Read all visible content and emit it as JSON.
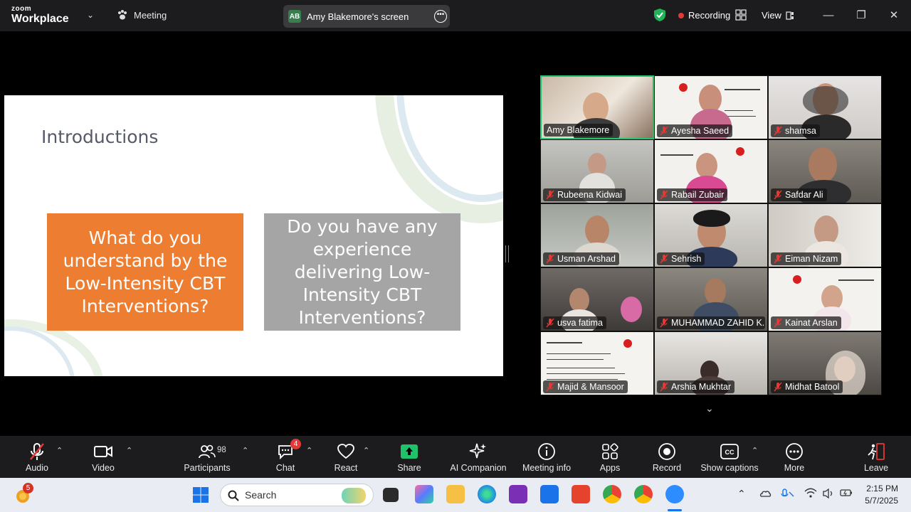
{
  "app": {
    "logo_top": "zoom",
    "logo_bottom": "Workplace"
  },
  "topbar": {
    "meeting_label": "Meeting",
    "screen_initials": "AB",
    "screen_title": "Amy Blakemore's screen",
    "recording_label": "Recording",
    "view_label": "View"
  },
  "slide": {
    "title": "Introductions",
    "box_left": "What do you understand by the Low-Intensity CBT Interventions?",
    "box_right": "Do you have any experience delivering Low-Intensity CBT Interventions?"
  },
  "participants": [
    {
      "name": "Amy Blakemore",
      "muted": false,
      "active": true
    },
    {
      "name": "Ayesha Saeed",
      "muted": true
    },
    {
      "name": "shamsa",
      "muted": true
    },
    {
      "name": "Rubeena Kidwai",
      "muted": true
    },
    {
      "name": "Rabail Zubair",
      "muted": true
    },
    {
      "name": "Safdar Ali",
      "muted": true
    },
    {
      "name": "Usman Arshad",
      "muted": true
    },
    {
      "name": "Sehrish",
      "muted": true
    },
    {
      "name": "Eiman Nizam",
      "muted": true
    },
    {
      "name": "usva fatima",
      "muted": true
    },
    {
      "name": "MUHAMMAD ZAHID K...",
      "muted": true
    },
    {
      "name": "Kainat Arslan",
      "muted": true
    },
    {
      "name": "Majid & Mansoor",
      "muted": true
    },
    {
      "name": "Arshia Mukhtar",
      "muted": true
    },
    {
      "name": "Midhat Batool",
      "muted": true
    }
  ],
  "toolbar": {
    "audio": "Audio",
    "video": "Video",
    "participants": "Participants",
    "participants_count": "98",
    "chat": "Chat",
    "chat_badge": "4",
    "react": "React",
    "share": "Share",
    "ai_companion": "AI Companion",
    "meeting_info": "Meeting info",
    "apps": "Apps",
    "record": "Record",
    "show_captions": "Show captions",
    "more": "More",
    "leave": "Leave"
  },
  "taskbar": {
    "widget_badge": "5",
    "search_placeholder": "Search",
    "time": "2:15 PM",
    "date": "5/7/2025"
  },
  "colors": {
    "accent_green": "#22c36a",
    "share_green": "#1fc16b",
    "leave_red": "#e53935",
    "slide_orange": "#ed7d31",
    "slide_gray": "#a5a5a5"
  }
}
